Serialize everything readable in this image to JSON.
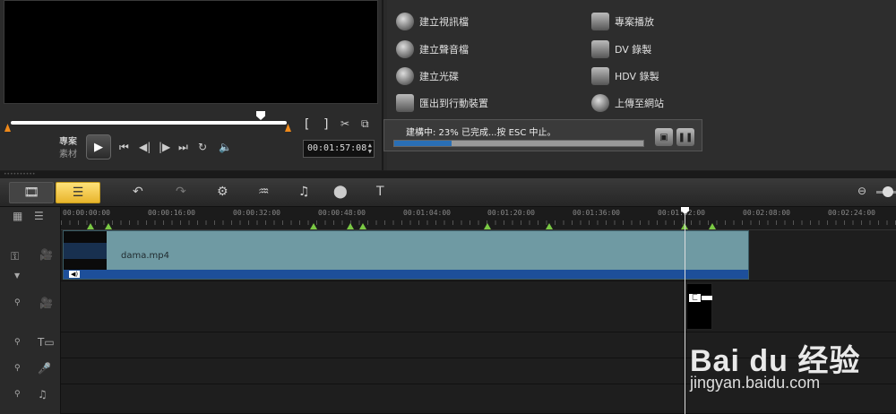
{
  "player": {
    "mode_project": "專案",
    "mode_clip": "素材",
    "bracket_in": "[",
    "bracket_out": "]",
    "timecode": "00:01:57:08",
    "controls": [
      "play-icon",
      "home-icon",
      "prev-frame-icon",
      "next-frame-icon",
      "end-icon",
      "repeat-icon",
      "volume-icon"
    ]
  },
  "tasks": {
    "items": [
      {
        "label": "建立視訊檔",
        "icon": "film-reel-icon"
      },
      {
        "label": "專案播放",
        "icon": "project-playback-icon"
      },
      {
        "label": "建立聲音檔",
        "icon": "audio-disc-icon"
      },
      {
        "label": "DV 錄製",
        "icon": "dv-camera-icon"
      },
      {
        "label": "建立光碟",
        "icon": "disc-icon"
      },
      {
        "label": "HDV 錄製",
        "icon": "hdv-camera-icon"
      },
      {
        "label": "匯出到行動裝置",
        "icon": "mobile-device-icon"
      },
      {
        "label": "上傳至網站",
        "icon": "globe-icon"
      }
    ],
    "render_status": "建構中: 23% 已完成...按 ESC 中止。",
    "render_progress": 0.23
  },
  "toolbar": {
    "storyboard_view": "storyboard-view-icon",
    "timeline_view": "timeline-view-icon",
    "tools": [
      "undo-icon",
      "redo-icon",
      "record-icon",
      "audio-mixer-icon",
      "auto-music-icon",
      "multi-trim-icon",
      "title-icon"
    ]
  },
  "timeline": {
    "ruler_labels": [
      "00:00:00:00",
      "00:00:16:00",
      "00:00:32:00",
      "00:00:48:00",
      "00:01:04:00",
      "00:01:20:00",
      "00:01:36:00",
      "00:01:52:00",
      "00:02:08:00",
      "00:02:24:00"
    ],
    "clip_name": "dama.mp4",
    "playhead_label": "00:01:57:08"
  },
  "watermark": {
    "logo": "Bai du 经验",
    "url": "jingyan.baidu.com"
  }
}
